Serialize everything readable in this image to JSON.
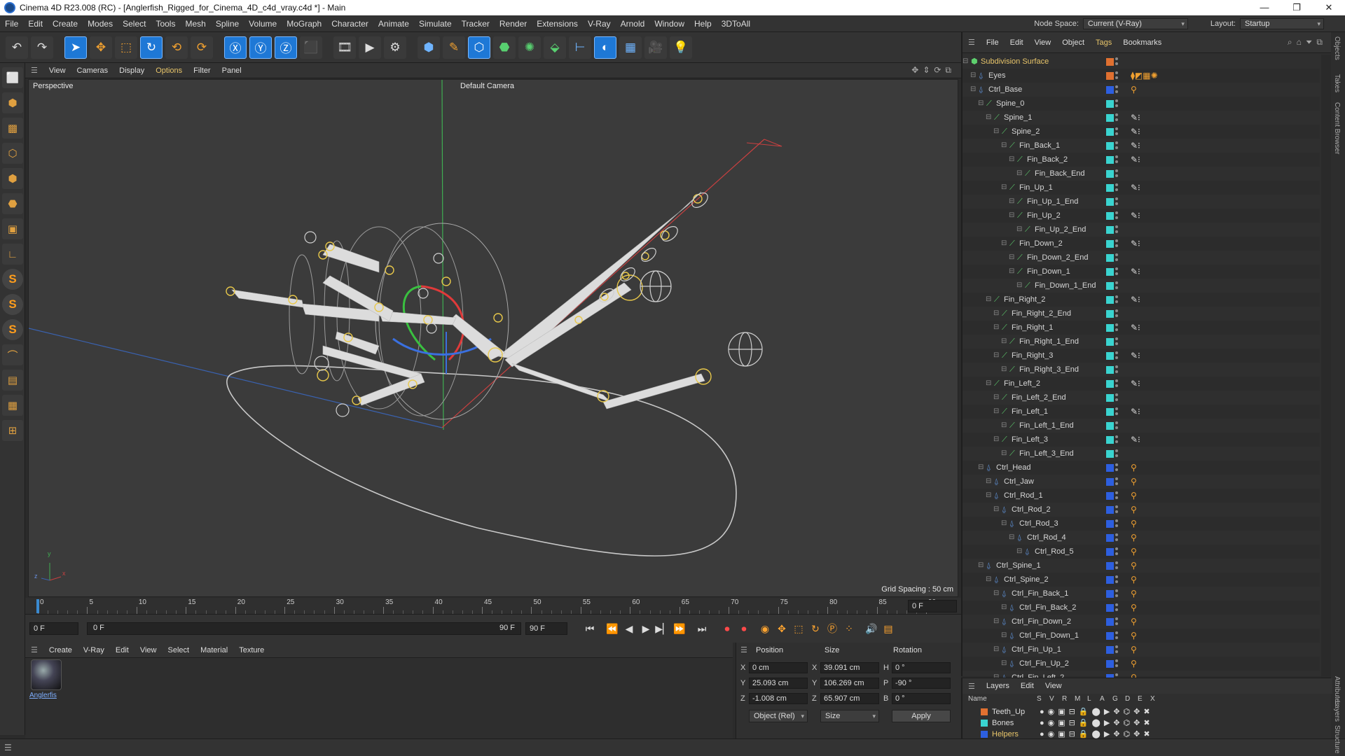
{
  "window": {
    "title": "Cinema 4D R23.008 (RC) - [Anglerfish_Rigged_for_Cinema_4D_c4d_vray.c4d *] - Main",
    "controls": [
      "—",
      "❐",
      "✕"
    ]
  },
  "menubar": {
    "items": [
      "File",
      "Edit",
      "Create",
      "Modes",
      "Select",
      "Tools",
      "Mesh",
      "Spline",
      "Volume",
      "MoGraph",
      "Character",
      "Animate",
      "Simulate",
      "Tracker",
      "Render",
      "Extensions",
      "V-Ray",
      "Arnold",
      "Window",
      "Help",
      "3DToAll"
    ],
    "node_space_label": "Node Space:",
    "node_space_value": "Current (V-Ray)",
    "layout_label": "Layout:",
    "layout_value": "Startup"
  },
  "viewport": {
    "menu": [
      "View",
      "Cameras",
      "Display",
      "Options",
      "Filter",
      "Panel"
    ],
    "name": "Perspective",
    "camera": "Default Camera",
    "grid_spacing": "Grid Spacing : 50 cm",
    "axis_y": "y",
    "axis_x": "x",
    "axis_z": "z"
  },
  "timeline": {
    "ticks": [
      "0",
      "5",
      "10",
      "15",
      "20",
      "25",
      "30",
      "35",
      "40",
      "45",
      "50",
      "55",
      "60",
      "65",
      "70",
      "75",
      "80",
      "85",
      "90"
    ],
    "current_frame": "0 F",
    "start_field": "0 F",
    "range_start": "0 F",
    "range_end": "90 F",
    "end_field": "90 F"
  },
  "material_panel": {
    "menu": [
      "Create",
      "V-Ray",
      "Edit",
      "View",
      "Select",
      "Material",
      "Texture"
    ],
    "material_name": "Anglerfis"
  },
  "coordinates": {
    "position_header": "Position",
    "size_header": "Size",
    "rotation_header": "Rotation",
    "rows": [
      {
        "axis": "X",
        "pos": "0 cm",
        "size_axis": "X",
        "size": "39.091 cm",
        "rot_axis": "H",
        "rot": "0 °"
      },
      {
        "axis": "Y",
        "pos": "25.093 cm",
        "size_axis": "Y",
        "size": "106.269 cm",
        "rot_axis": "P",
        "rot": "-90 °"
      },
      {
        "axis": "Z",
        "pos": "-1.008 cm",
        "size_axis": "Z",
        "size": "65.907 cm",
        "rot_axis": "B",
        "rot": "0 °"
      }
    ],
    "mode_dropdown": "Object (Rel)",
    "size_dropdown": "Size",
    "apply_label": "Apply"
  },
  "object_manager": {
    "menu": [
      "File",
      "Edit",
      "View",
      "Object",
      "Tags",
      "Bookmarks"
    ],
    "objects": [
      {
        "name": "Subdivision Surface",
        "depth": 0,
        "icon": "sub",
        "layer": "#e07030",
        "selected": true
      },
      {
        "name": "Eyes",
        "depth": 1,
        "icon": "null",
        "layer": "#e07030",
        "tag": "texture-tags"
      },
      {
        "name": "Ctrl_Base",
        "depth": 1,
        "icon": "null",
        "layer": "#2d5fe0",
        "tag": "o"
      },
      {
        "name": "Spine_0",
        "depth": 2,
        "icon": "bone",
        "layer": "#3ad4d0"
      },
      {
        "name": "Spine_1",
        "depth": 3,
        "icon": "bone",
        "layer": "#3ad4d0",
        "tag": "ik"
      },
      {
        "name": "Spine_2",
        "depth": 4,
        "icon": "bone",
        "layer": "#3ad4d0",
        "tag": "ik"
      },
      {
        "name": "Fin_Back_1",
        "depth": 5,
        "icon": "bone",
        "layer": "#3ad4d0",
        "tag": "ik"
      },
      {
        "name": "Fin_Back_2",
        "depth": 6,
        "icon": "bone",
        "layer": "#3ad4d0",
        "tag": "ik"
      },
      {
        "name": "Fin_Back_End",
        "depth": 7,
        "icon": "bone",
        "layer": "#3ad4d0"
      },
      {
        "name": "Fin_Up_1",
        "depth": 5,
        "icon": "bone",
        "layer": "#3ad4d0",
        "tag": "ik"
      },
      {
        "name": "Fin_Up_1_End",
        "depth": 6,
        "icon": "bone",
        "layer": "#3ad4d0"
      },
      {
        "name": "Fin_Up_2",
        "depth": 6,
        "icon": "bone",
        "layer": "#3ad4d0",
        "tag": "ik"
      },
      {
        "name": "Fin_Up_2_End",
        "depth": 7,
        "icon": "bone",
        "layer": "#3ad4d0"
      },
      {
        "name": "Fin_Down_2",
        "depth": 5,
        "icon": "bone",
        "layer": "#3ad4d0",
        "tag": "ik"
      },
      {
        "name": "Fin_Down_2_End",
        "depth": 6,
        "icon": "bone",
        "layer": "#3ad4d0"
      },
      {
        "name": "Fin_Down_1",
        "depth": 6,
        "icon": "bone",
        "layer": "#3ad4d0",
        "tag": "ik"
      },
      {
        "name": "Fin_Down_1_End",
        "depth": 7,
        "icon": "bone",
        "layer": "#3ad4d0"
      },
      {
        "name": "Fin_Right_2",
        "depth": 3,
        "icon": "bone",
        "layer": "#3ad4d0",
        "tag": "ik"
      },
      {
        "name": "Fin_Right_2_End",
        "depth": 4,
        "icon": "bone",
        "layer": "#3ad4d0"
      },
      {
        "name": "Fin_Right_1",
        "depth": 4,
        "icon": "bone",
        "layer": "#3ad4d0",
        "tag": "ik"
      },
      {
        "name": "Fin_Right_1_End",
        "depth": 5,
        "icon": "bone",
        "layer": "#3ad4d0"
      },
      {
        "name": "Fin_Right_3",
        "depth": 4,
        "icon": "bone",
        "layer": "#3ad4d0",
        "tag": "ik"
      },
      {
        "name": "Fin_Right_3_End",
        "depth": 5,
        "icon": "bone",
        "layer": "#3ad4d0"
      },
      {
        "name": "Fin_Left_2",
        "depth": 3,
        "icon": "bone",
        "layer": "#3ad4d0",
        "tag": "ik"
      },
      {
        "name": "Fin_Left_2_End",
        "depth": 4,
        "icon": "bone",
        "layer": "#3ad4d0"
      },
      {
        "name": "Fin_Left_1",
        "depth": 4,
        "icon": "bone",
        "layer": "#3ad4d0",
        "tag": "ik"
      },
      {
        "name": "Fin_Left_1_End",
        "depth": 5,
        "icon": "bone",
        "layer": "#3ad4d0"
      },
      {
        "name": "Fin_Left_3",
        "depth": 4,
        "icon": "bone",
        "layer": "#3ad4d0",
        "tag": "ik"
      },
      {
        "name": "Fin_Left_3_End",
        "depth": 5,
        "icon": "bone",
        "layer": "#3ad4d0"
      },
      {
        "name": "Ctrl_Head",
        "depth": 2,
        "icon": "null",
        "layer": "#2d5fe0",
        "tag": "o"
      },
      {
        "name": "Ctrl_Jaw",
        "depth": 3,
        "icon": "null",
        "layer": "#2d5fe0",
        "tag": "o"
      },
      {
        "name": "Ctrl_Rod_1",
        "depth": 3,
        "icon": "null",
        "layer": "#2d5fe0",
        "tag": "o"
      },
      {
        "name": "Ctrl_Rod_2",
        "depth": 4,
        "icon": "null",
        "layer": "#2d5fe0",
        "tag": "o"
      },
      {
        "name": "Ctrl_Rod_3",
        "depth": 5,
        "icon": "null",
        "layer": "#2d5fe0",
        "tag": "o"
      },
      {
        "name": "Ctrl_Rod_4",
        "depth": 6,
        "icon": "null",
        "layer": "#2d5fe0",
        "tag": "o"
      },
      {
        "name": "Ctrl_Rod_5",
        "depth": 7,
        "icon": "null",
        "layer": "#2d5fe0",
        "tag": "o"
      },
      {
        "name": "Ctrl_Spine_1",
        "depth": 2,
        "icon": "null",
        "layer": "#2d5fe0",
        "tag": "o"
      },
      {
        "name": "Ctrl_Spine_2",
        "depth": 3,
        "icon": "null",
        "layer": "#2d5fe0",
        "tag": "o"
      },
      {
        "name": "Ctrl_Fin_Back_1",
        "depth": 4,
        "icon": "null",
        "layer": "#2d5fe0",
        "tag": "o"
      },
      {
        "name": "Ctrl_Fin_Back_2",
        "depth": 5,
        "icon": "null",
        "layer": "#2d5fe0",
        "tag": "o"
      },
      {
        "name": "Ctrl_Fin_Down_2",
        "depth": 4,
        "icon": "null",
        "layer": "#2d5fe0",
        "tag": "o"
      },
      {
        "name": "Ctrl_Fin_Down_1",
        "depth": 5,
        "icon": "null",
        "layer": "#2d5fe0",
        "tag": "o"
      },
      {
        "name": "Ctrl_Fin_Up_1",
        "depth": 4,
        "icon": "null",
        "layer": "#2d5fe0",
        "tag": "o"
      },
      {
        "name": "Ctrl_Fin_Up_2",
        "depth": 5,
        "icon": "null",
        "layer": "#2d5fe0",
        "tag": "o"
      },
      {
        "name": "Ctrl_Fin_Left_2",
        "depth": 4,
        "icon": "null",
        "layer": "#2d5fe0",
        "tag": "o"
      }
    ]
  },
  "layers": {
    "menu": [
      "Layers",
      "Edit",
      "View"
    ],
    "columns": [
      "Name",
      "S",
      "V",
      "R",
      "M",
      "L",
      "A",
      "G",
      "D",
      "E",
      "X"
    ],
    "items": [
      {
        "name": "Teeth_Up",
        "color": "#e07030",
        "highlight": false
      },
      {
        "name": "Bones",
        "color": "#3ad4d0",
        "highlight": false
      },
      {
        "name": "Helpers",
        "color": "#2d5fe0",
        "highlight": true
      }
    ]
  },
  "side_tabs": [
    "Objects",
    "Takes",
    "Content Browser",
    "Attributes",
    "Layers",
    "Structure"
  ],
  "colors": {
    "accent_menu": "#e8c56a",
    "selection_blue": "#1e78d6",
    "bone_layer": "#3ad4d0",
    "helper_layer": "#2d5fe0",
    "mesh_layer": "#e07030"
  }
}
